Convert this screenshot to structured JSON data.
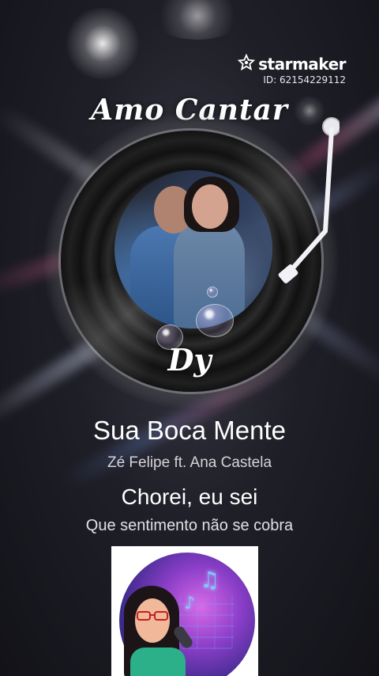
{
  "app": {
    "brand_name": "starmaker",
    "user_id_text": "ID: 62154229112",
    "brand_icon": "star-icon"
  },
  "overlay": {
    "top_script": "Amo Cantar",
    "bottom_script": "Dy"
  },
  "song": {
    "title": "Sua Boca Mente",
    "artist": "Zé Felipe ft. Ana Castela"
  },
  "lyrics": {
    "current_line": "Chorei, eu sei",
    "next_line": "Que sentimento não se cobra"
  },
  "icons": {
    "record": "vinyl-record-icon",
    "tonearm": "tonearm-icon",
    "music_note": "music-note-icon"
  },
  "colors": {
    "background": "#1f1f28",
    "text_primary": "#ffffff",
    "text_secondary": "#d4d4d8"
  }
}
